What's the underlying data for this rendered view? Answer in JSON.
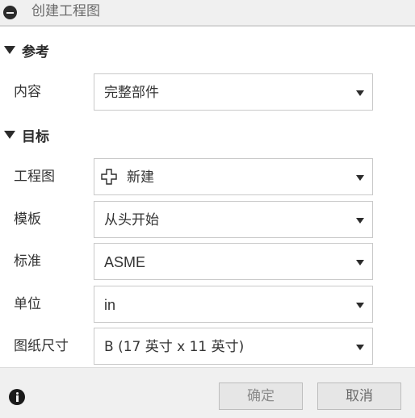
{
  "dialog": {
    "title": "创建工程图",
    "collapse_icon": "minus-circle-icon"
  },
  "sections": {
    "reference": {
      "title": "参考",
      "content_label": "内容",
      "content_value": "完整部件"
    },
    "target": {
      "title": "目标",
      "drawing_label": "工程图",
      "drawing_value": "新建",
      "drawing_icon": "new-plus-icon",
      "template_label": "模板",
      "template_value": "从头开始",
      "standard_label": "标准",
      "standard_value": "ASME",
      "units_label": "单位",
      "units_value": "in",
      "sheet_size_label": "图纸尺寸",
      "sheet_size_value": "B (17 英寸 x 11 英寸)"
    }
  },
  "footer": {
    "info_icon": "info-icon",
    "ok_label": "确定",
    "cancel_label": "取消"
  }
}
